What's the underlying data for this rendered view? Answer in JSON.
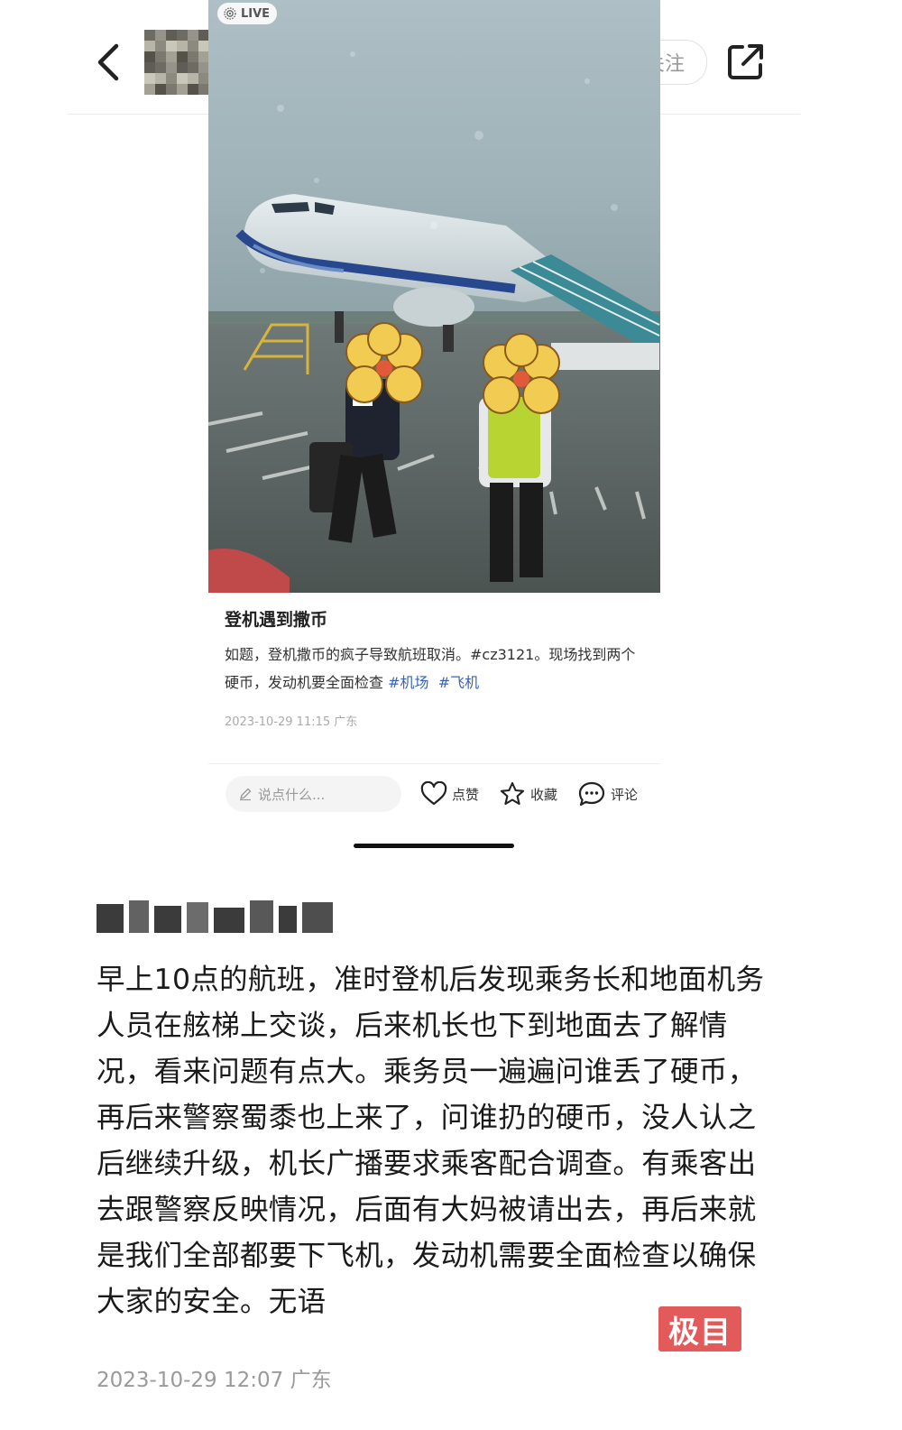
{
  "header": {
    "follow_label": "关注",
    "back_icon": "chevron-left-icon",
    "share_icon": "share-external-icon"
  },
  "photo": {
    "live_label": "LIVE"
  },
  "card": {
    "title": "登机遇到撒币",
    "desc_text": "如题，登机撒币的疯子导致航班取消。#cz3121。现场找到两个硬币，发动机要全面检查",
    "tags": [
      "#机场",
      "#飞机"
    ],
    "time": "2023-10-29 11:15 广东",
    "comment_placeholder": "说点什么...",
    "actions": {
      "like": "点赞",
      "favorite": "收藏",
      "comment": "评论"
    }
  },
  "post": {
    "body": "早上10点的航班，准时登机后发现乘务长和地面机务人员在舷梯上交谈，后来机长也下到地面去了解情况，看来问题有点大。乘务员一遍遍问谁丢了硬币，再后来警察蜀黍也上来了，问谁扔的硬币，没人认之后继续升级，机长广播要求乘客配合调查。有乘客出去跟警察反映情况，后面有大妈被请出去，再后来就是我们全部都要下飞机，发动机需要全面检查以确保大家的安全。无语",
    "time": "2023-10-29 12:07 广东"
  },
  "watermark": "极目",
  "colors": {
    "tag": "#3a64b5",
    "watermark_bg": "#e35a5a"
  }
}
